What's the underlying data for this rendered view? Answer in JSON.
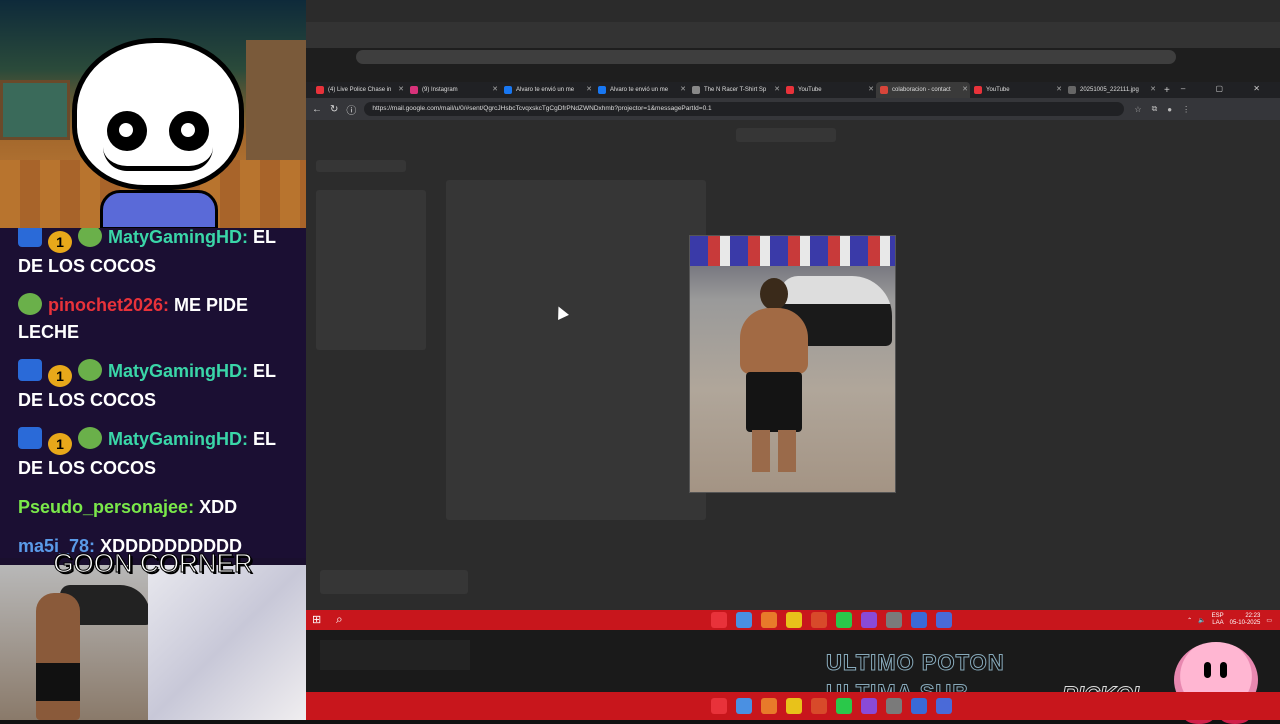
{
  "chat": {
    "messages": [
      {
        "user": "MatyGamingHD:",
        "text": " EL DE LOS COCOS",
        "color": "#3ad6a8",
        "badges": [
          "sub",
          "one",
          "frog"
        ]
      },
      {
        "user": "pinochet2026:",
        "text": " ME PIDE LECHE",
        "color": "#e8323a",
        "badges": [
          "frog"
        ]
      },
      {
        "user": "MatyGamingHD:",
        "text": " EL DE LOS COCOS",
        "color": "#3ad6a8",
        "badges": [
          "sub",
          "one",
          "frog"
        ]
      },
      {
        "user": "MatyGamingHD:",
        "text": " EL DE LOS COCOS",
        "color": "#3ad6a8",
        "badges": [
          "sub",
          "one",
          "frog"
        ]
      },
      {
        "user": "Pseudo_personajee:",
        "text": " XDD",
        "color": "#7ae84a",
        "badges": []
      },
      {
        "user": "ma5i_78:",
        "text": " XDDDDDDDDDD",
        "color": "#5a9ae8",
        "badges": []
      }
    ],
    "badge_one": "1"
  },
  "overlay": {
    "goon_corner": "GOON CORNER",
    "ultimo_poton": "ULTIMO POTON",
    "ultima_sub": "ULTIMA SUB",
    "rickoi": "RICKOI"
  },
  "browser": {
    "tabs": [
      {
        "label": "(4) Live Police Chase in",
        "color": "#e8323a"
      },
      {
        "label": "(9) Instagram",
        "color": "#d8327a"
      },
      {
        "label": "Alvaro te envió un me",
        "color": "#1877f2"
      },
      {
        "label": "Alvaro te envió un me",
        "color": "#1877f2"
      },
      {
        "label": "The N Racer T-Shirt Sp",
        "color": "#888888"
      },
      {
        "label": "YouTube",
        "color": "#e8323a"
      },
      {
        "label": "colaboracion - contact",
        "color": "#d8453a"
      },
      {
        "label": "YouTube",
        "color": "#e8323a"
      },
      {
        "label": "20251005_222111.jpg",
        "color": "#666666"
      }
    ],
    "active_tab": 6,
    "url": "https://mail.google.com/mail/u/0/#sent/QgrcJHsbcTcvqxskcTgCgDfrPNdZWNDxhmb?projector=1&messagePartId=0.1",
    "new_tab": "+"
  },
  "taskbar": {
    "lang": "ESP",
    "lang2": "LAA",
    "time": "22:23",
    "date": "05-10-2025",
    "app_colors": [
      "#e8323a",
      "#4a90e2",
      "#e87a2a",
      "#e8c21a",
      "#d84a2a",
      "#2ac84a",
      "#8a4ad8",
      "#7a7a7a",
      "#3a6ad8",
      "#4a6ad8"
    ]
  },
  "colors": {
    "taskbar": "#c8161c",
    "chat_bg": "#1b0f33"
  }
}
